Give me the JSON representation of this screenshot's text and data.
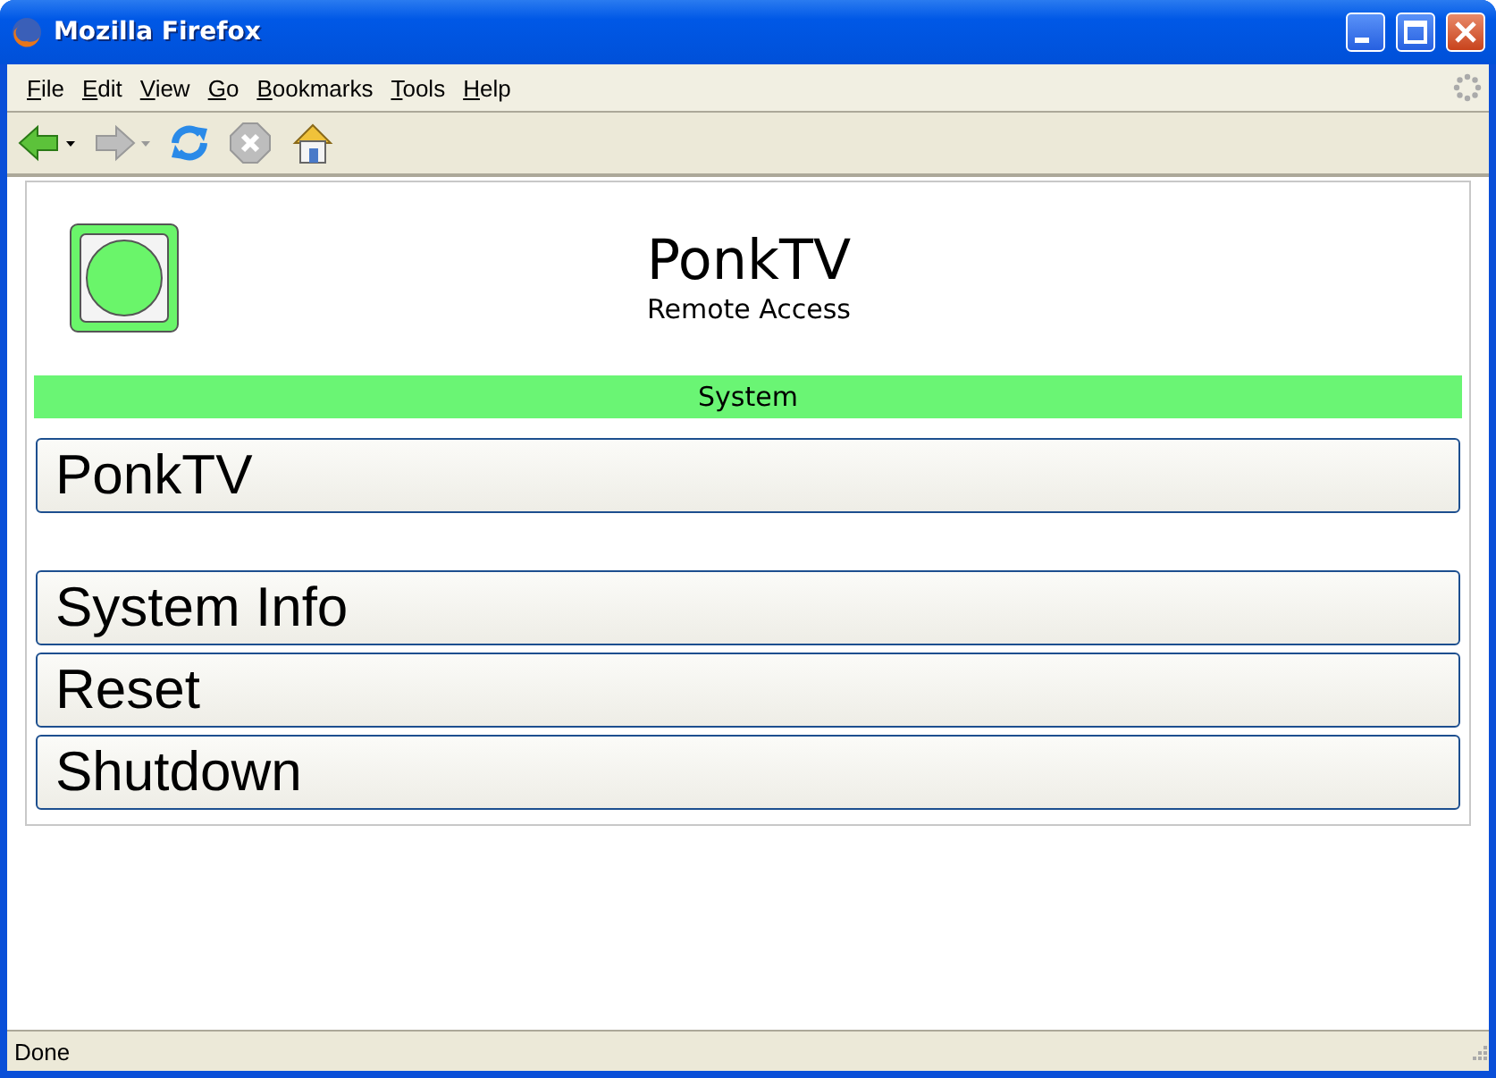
{
  "window": {
    "title": "Mozilla Firefox"
  },
  "menu_bar": [
    "File",
    "Edit",
    "View",
    "Go",
    "Bookmarks",
    "Tools",
    "Help"
  ],
  "toolbar": [
    {
      "kind": "back",
      "disabled": false,
      "dropdown": true
    },
    {
      "kind": "forward",
      "disabled": true,
      "dropdown": true
    },
    {
      "kind": "reload",
      "disabled": false,
      "dropdown": false
    },
    {
      "kind": "stop",
      "disabled": true,
      "dropdown": false
    },
    {
      "kind": "home",
      "disabled": false,
      "dropdown": false
    }
  ],
  "page": {
    "title": "PonkTV",
    "subtitle": "Remote Access",
    "section": "System",
    "button_groups": [
      [
        "PonkTV"
      ],
      [
        "System Info",
        "Reset",
        "Shutdown"
      ]
    ]
  },
  "status_bar": "Done"
}
